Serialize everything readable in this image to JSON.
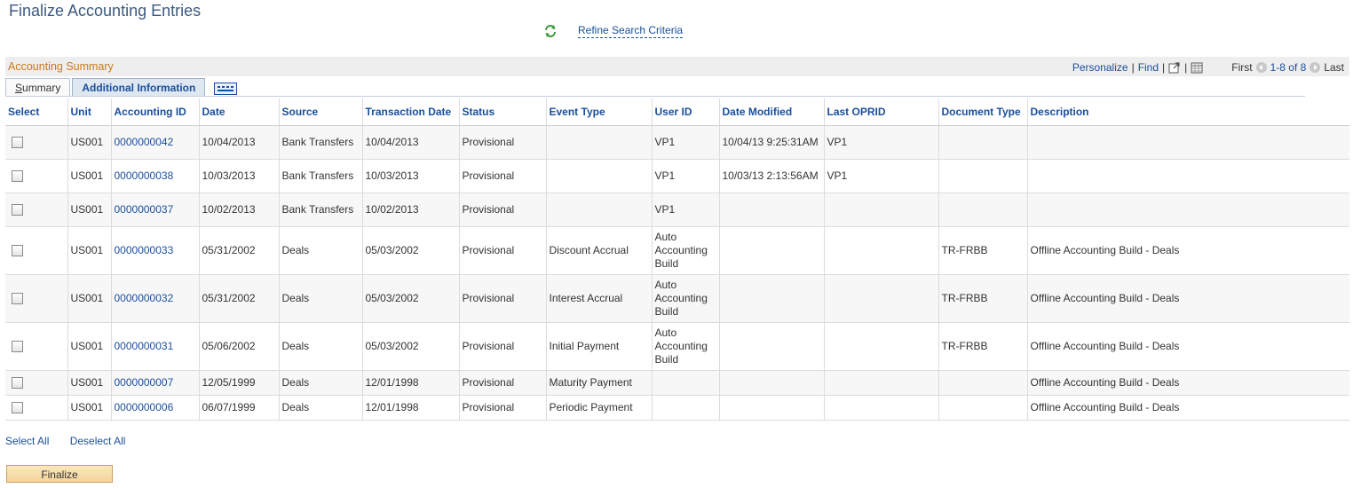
{
  "page": {
    "title": "Finalize Accounting Entries",
    "refine_link": "Refine Search Criteria"
  },
  "grid": {
    "title": "Accounting Summary",
    "nav": {
      "personalize": "Personalize",
      "find": "Find",
      "first": "First",
      "range": "1-8 of 8",
      "last": "Last"
    },
    "tabs": {
      "summary": "ummary",
      "summary_prefix": "S",
      "additional": "Additional Information"
    },
    "columns": [
      "Select",
      "Unit",
      "Accounting ID",
      "Date",
      "Source",
      "Transaction Date",
      "Status",
      "Event Type",
      "User ID",
      "Date Modified",
      "Last OPRID",
      "Document Type",
      "Description"
    ],
    "rows": [
      {
        "unit": "US001",
        "accounting_id": "0000000042",
        "date": "10/04/2013",
        "source": "Bank Transfers",
        "transaction_date": "10/04/2013",
        "status": "Provisional",
        "event_type": "",
        "user_id": "VP1",
        "date_modified": "10/04/13  9:25:31AM",
        "last_oprid": "VP1",
        "document_type": "",
        "description": ""
      },
      {
        "unit": "US001",
        "accounting_id": "0000000038",
        "date": "10/03/2013",
        "source": "Bank Transfers",
        "transaction_date": "10/03/2013",
        "status": "Provisional",
        "event_type": "",
        "user_id": "VP1",
        "date_modified": "10/03/13  2:13:56AM",
        "last_oprid": "VP1",
        "document_type": "",
        "description": ""
      },
      {
        "unit": "US001",
        "accounting_id": "0000000037",
        "date": "10/02/2013",
        "source": "Bank Transfers",
        "transaction_date": "10/02/2013",
        "status": "Provisional",
        "event_type": "",
        "user_id": "VP1",
        "date_modified": "",
        "last_oprid": "",
        "document_type": "",
        "description": ""
      },
      {
        "unit": "US001",
        "accounting_id": "0000000033",
        "date": "05/31/2002",
        "source": "Deals",
        "transaction_date": "05/03/2002",
        "status": "Provisional",
        "event_type": "Discount Accrual",
        "user_id": "Auto\nAccounting\nBuild",
        "date_modified": "",
        "last_oprid": "",
        "document_type": "TR-FRBB",
        "description": "Offline Accounting Build - Deals"
      },
      {
        "unit": "US001",
        "accounting_id": "0000000032",
        "date": "05/31/2002",
        "source": "Deals",
        "transaction_date": "05/03/2002",
        "status": "Provisional",
        "event_type": "Interest Accrual",
        "user_id": "Auto\nAccounting\nBuild",
        "date_modified": "",
        "last_oprid": "",
        "document_type": "TR-FRBB",
        "description": "Offline Accounting Build - Deals"
      },
      {
        "unit": "US001",
        "accounting_id": "0000000031",
        "date": "05/06/2002",
        "source": "Deals",
        "transaction_date": "05/03/2002",
        "status": "Provisional",
        "event_type": "Initial Payment",
        "user_id": "Auto\nAccounting\nBuild",
        "date_modified": "",
        "last_oprid": "",
        "document_type": "TR-FRBB",
        "description": "Offline Accounting Build - Deals"
      },
      {
        "unit": "US001",
        "accounting_id": "0000000007",
        "date": "12/05/1999",
        "source": "Deals",
        "transaction_date": "12/01/1998",
        "status": "Provisional",
        "event_type": "Maturity Payment",
        "user_id": "",
        "date_modified": "",
        "last_oprid": "",
        "document_type": "",
        "description": "Offline Accounting Build  - Deals"
      },
      {
        "unit": "US001",
        "accounting_id": "0000000006",
        "date": "06/07/1999",
        "source": "Deals",
        "transaction_date": "12/01/1998",
        "status": "Provisional",
        "event_type": "Periodic Payment",
        "user_id": "",
        "date_modified": "",
        "last_oprid": "",
        "document_type": "",
        "description": "Offline Accounting Build  - Deals"
      }
    ]
  },
  "actions": {
    "select_all": "Select All",
    "deselect_all": "Deselect All",
    "finalize": "Finalize"
  },
  "icons": {
    "refresh": "refresh-icon",
    "zoom": "zoom-icon",
    "download": "download-grid-icon",
    "expand": "show-all-columns-icon"
  },
  "colors": {
    "link": "#1a4f9c",
    "section_title": "#c87a1b",
    "button": "#f3d59a"
  }
}
